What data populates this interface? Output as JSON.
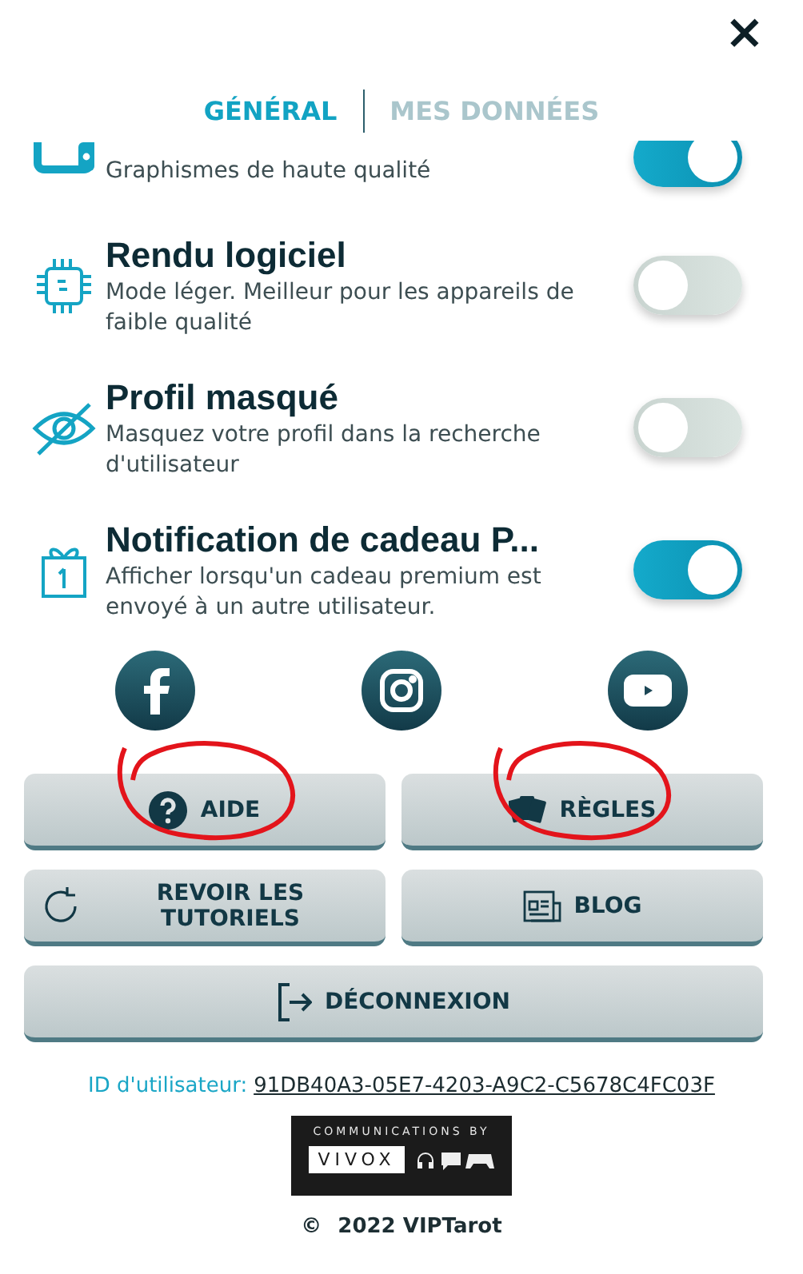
{
  "close": "×",
  "tabs": [
    {
      "label": "GÉNÉRAL",
      "selected": true
    },
    {
      "label": "MES DONNÉES",
      "selected": false
    }
  ],
  "settings": [
    {
      "kind": "monitor",
      "description": "Graphismes de haute qualité",
      "on": true
    },
    {
      "kind": "chip",
      "title": "Rendu logiciel",
      "description": "Mode léger. Meilleur pour les appareils de faible qualité",
      "on": false
    },
    {
      "kind": "eye-off",
      "title": "Profil masqué",
      "description": "Masquez votre profil dans la recherche d'utilisateur",
      "on": false
    },
    {
      "kind": "gift",
      "title": "Notification de cadeau P...",
      "description": "Afficher lorsqu'un cadeau premium est envoyé à un autre utilisateur.",
      "on": true
    }
  ],
  "social": [
    {
      "kind": "facebook"
    },
    {
      "kind": "instagram"
    },
    {
      "kind": "youtube"
    }
  ],
  "buttons": [
    {
      "kind": "help",
      "label": "AIDE",
      "annotated": true
    },
    {
      "kind": "rules",
      "label": "RÈGLES",
      "annotated": true
    },
    {
      "kind": "tutorials",
      "label": "REVOIR LES TUTORIELS",
      "annotated": false
    },
    {
      "kind": "blog",
      "label": "BLOG",
      "annotated": false
    },
    {
      "kind": "logout",
      "label": "DÉCONNEXION",
      "annotated": false
    }
  ],
  "user_id": {
    "label": "ID d'utilisateur:",
    "value": "91DB40A3-05E7-4203-A9C2-C5678C4FC03F"
  },
  "vivox": {
    "caption": "COMMUNICATIONS BY",
    "name": "VIVOX"
  },
  "copyright": {
    "symbol": "©",
    "text": "2022 VIPTarot"
  }
}
